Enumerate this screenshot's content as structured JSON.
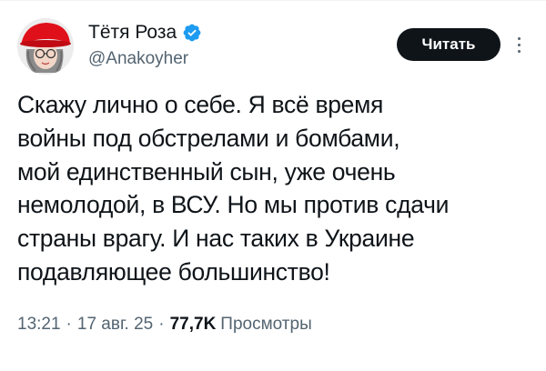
{
  "author": {
    "display_name": "Тётя Роза",
    "handle": "@Anakoyher",
    "verified": true,
    "avatar_icon": "avatar-red-hat-woman-icon"
  },
  "actions": {
    "follow_label": "Читать",
    "more_icon": "more-vertical-icon"
  },
  "tweet": {
    "text_lines": [
      "Скажу лично о себе. Я всё время",
      "войны под обстрелами и бомбами,",
      "мой единственный сын, уже очень",
      "немолодой, в ВСУ. Но мы против сдачи",
      "страны врагу. И нас таких в Украине",
      "подавляющее большинство!"
    ]
  },
  "meta": {
    "time": "13:21",
    "separator": "·",
    "date": "17 авг. 25",
    "views_count": "77,7K",
    "views_label": "Просмотры"
  },
  "colors": {
    "text": "#0f1419",
    "secondary": "#536471",
    "verified_badge": "#1d9bf0",
    "button_bg": "#0f1419",
    "avatar_hat": "#e0101a"
  }
}
